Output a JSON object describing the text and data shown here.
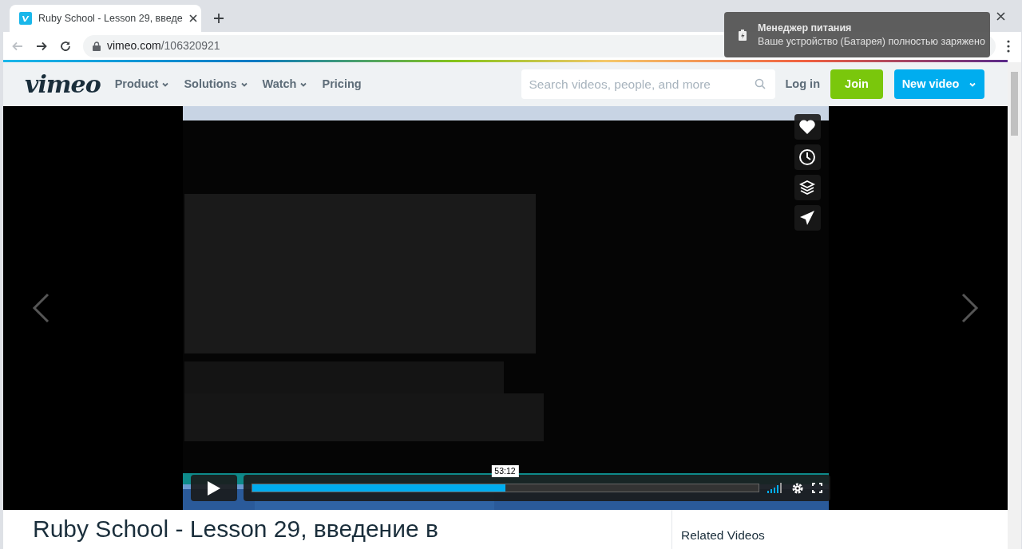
{
  "browser": {
    "tab": {
      "title": "Ruby School - Lesson 29, введе",
      "selected": true
    },
    "address": {
      "domain": "vimeo.com",
      "path": "/106320921"
    }
  },
  "notification": {
    "title": "Менеджер питания",
    "message": "Ваше устройство (Батарея) полностью заряжено"
  },
  "header": {
    "logo": "vimeo",
    "nav": [
      {
        "label": "Product",
        "dropdown": true
      },
      {
        "label": "Solutions",
        "dropdown": true
      },
      {
        "label": "Watch",
        "dropdown": true
      },
      {
        "label": "Pricing",
        "dropdown": false
      }
    ],
    "search": {
      "placeholder": "Search videos, people, and more"
    },
    "login": "Log in",
    "join": "Join",
    "new_video": "New video"
  },
  "player": {
    "time_tooltip": "53:12",
    "progress": {
      "level": 0.5
    }
  },
  "video_title": "Ruby School - Lesson 29, введение в",
  "sidebar": {
    "heading": "Related Videos"
  }
}
